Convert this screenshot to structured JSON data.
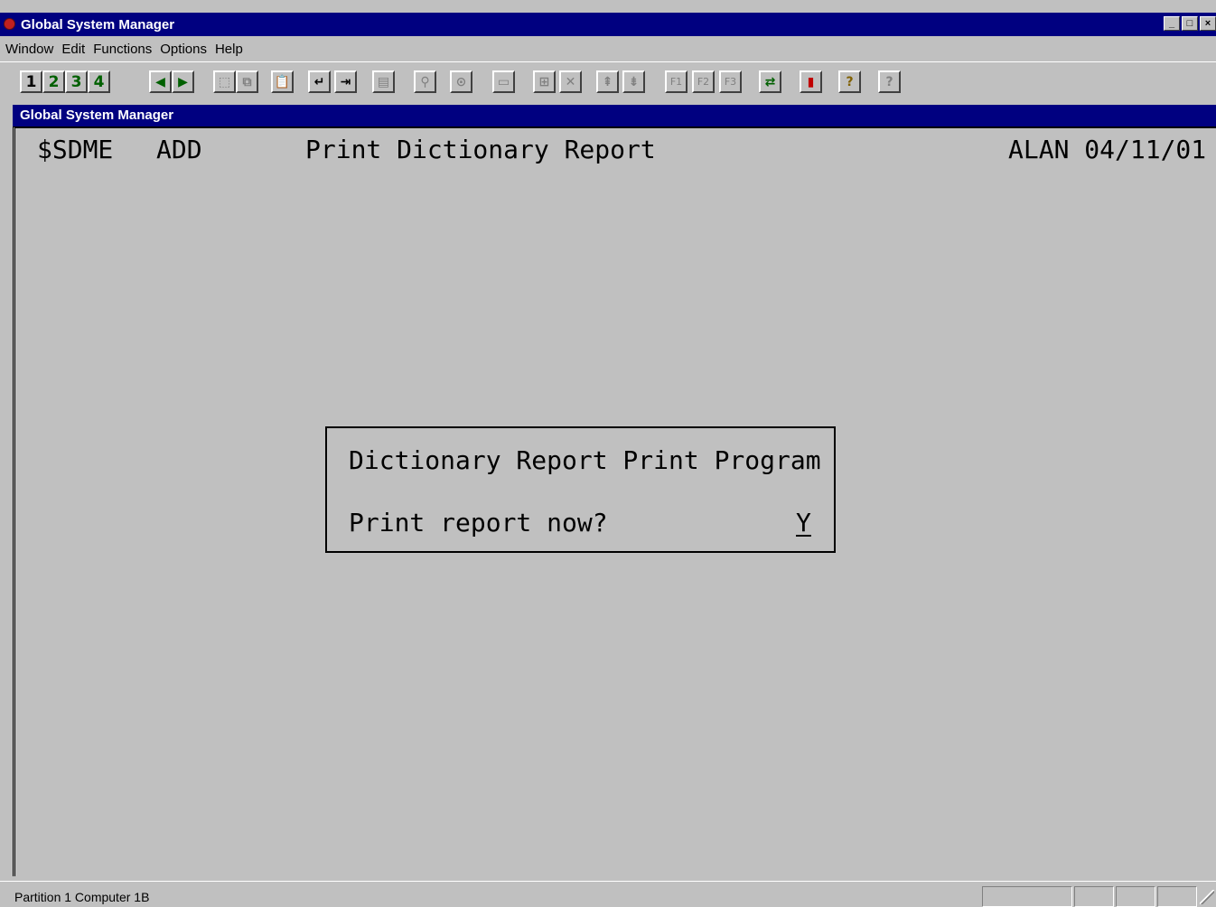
{
  "window": {
    "title": "Global System Manager",
    "controls": [
      "_",
      "□",
      "×"
    ]
  },
  "menu": [
    "Window",
    "Edit",
    "Functions",
    "Options",
    "Help"
  ],
  "toolbar": {
    "buttons": [
      {
        "id": "1",
        "glyph": "1"
      },
      {
        "id": "2",
        "glyph": "2"
      },
      {
        "id": "3",
        "glyph": "3"
      },
      {
        "id": "4",
        "glyph": "4"
      },
      {
        "id": "prev",
        "glyph": "◀"
      },
      {
        "id": "next",
        "glyph": "▶"
      },
      {
        "id": "select",
        "glyph": "⬚"
      },
      {
        "id": "copy",
        "glyph": "⧉"
      },
      {
        "id": "paste",
        "glyph": "📋"
      },
      {
        "id": "enter",
        "glyph": "↵"
      },
      {
        "id": "exit",
        "glyph": "⇥"
      },
      {
        "id": "doc",
        "glyph": "▤"
      },
      {
        "id": "find",
        "glyph": "⚲"
      },
      {
        "id": "binoculars",
        "glyph": "⊙"
      },
      {
        "id": "form",
        "glyph": "▭"
      },
      {
        "id": "insert",
        "glyph": "⊞"
      },
      {
        "id": "delete",
        "glyph": "✕"
      },
      {
        "id": "page-up",
        "glyph": "⇞"
      },
      {
        "id": "page-down",
        "glyph": "⇟"
      },
      {
        "id": "f1",
        "glyph": "F1"
      },
      {
        "id": "f2",
        "glyph": "F2"
      },
      {
        "id": "f3",
        "glyph": "F3"
      },
      {
        "id": "transfer",
        "glyph": "⇄"
      },
      {
        "id": "chart",
        "glyph": "▮"
      },
      {
        "id": "help",
        "glyph": "?"
      },
      {
        "id": "context-help",
        "glyph": "?"
      }
    ]
  },
  "subwindow": {
    "title": "Global System Manager"
  },
  "screen": {
    "program": "$SDME",
    "mode": "ADD",
    "heading": "Print Dictionary Report",
    "user_date": "ALAN 04/11/01"
  },
  "dialog": {
    "title": "Dictionary Report Print Program",
    "prompt": "Print report now?",
    "answer": "Y"
  },
  "status": {
    "text": "Partition 1 Computer 1B"
  },
  "colors": {
    "titlebar": "#000080",
    "face": "#c0c0c0"
  }
}
